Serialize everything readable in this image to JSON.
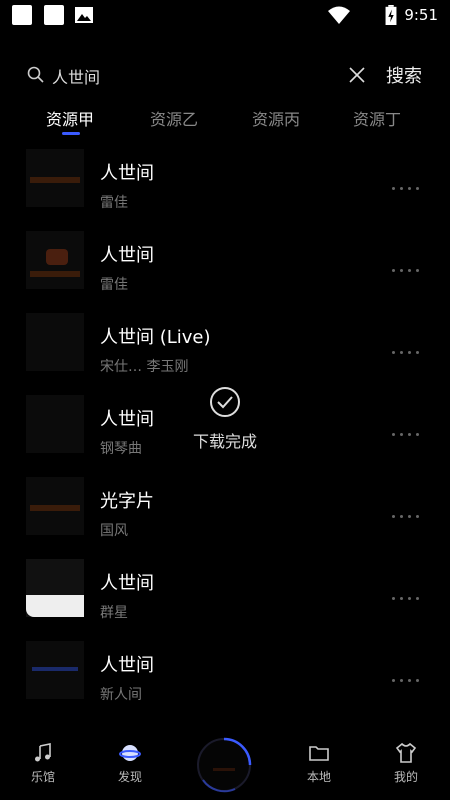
{
  "status_bar": {
    "time": "9:51",
    "icons": [
      "notification-square-icon",
      "notification-square-icon",
      "image-icon",
      "wifi-icon",
      "battery-charging-icon"
    ]
  },
  "search": {
    "value": "人世间",
    "submit_label": "搜索"
  },
  "tabs": [
    {
      "label": "资源甲",
      "active": true
    },
    {
      "label": "资源乙",
      "active": false
    },
    {
      "label": "资源丙",
      "active": false
    },
    {
      "label": "资源丁",
      "active": false
    }
  ],
  "songs": [
    {
      "title": "人世间",
      "artist": "雷佳"
    },
    {
      "title": "人世间",
      "artist": "雷佳"
    },
    {
      "title": "人世间 (Live)",
      "artist": "宋仕… 李玉刚"
    },
    {
      "title": "人世间",
      "artist": "钢琴曲"
    },
    {
      "title": "光字片",
      "artist": "国风"
    },
    {
      "title": "人世间",
      "artist": "群星"
    },
    {
      "title": "人世间",
      "artist": "新人间"
    }
  ],
  "toast": {
    "text": "下载完成",
    "icon": "check-circle-icon"
  },
  "bottom_nav": {
    "items": [
      {
        "label": "乐馆",
        "icon": "music-note-icon"
      },
      {
        "label": "发现",
        "icon": "planet-icon"
      },
      {
        "label": "",
        "icon": "player-disc-icon"
      },
      {
        "label": "本地",
        "icon": "folder-icon"
      },
      {
        "label": "我的",
        "icon": "shirt-icon"
      }
    ]
  },
  "colors": {
    "background": "#000000",
    "accent": "#3b5bff",
    "text_primary": "#ffffff",
    "text_secondary": "#777777"
  }
}
